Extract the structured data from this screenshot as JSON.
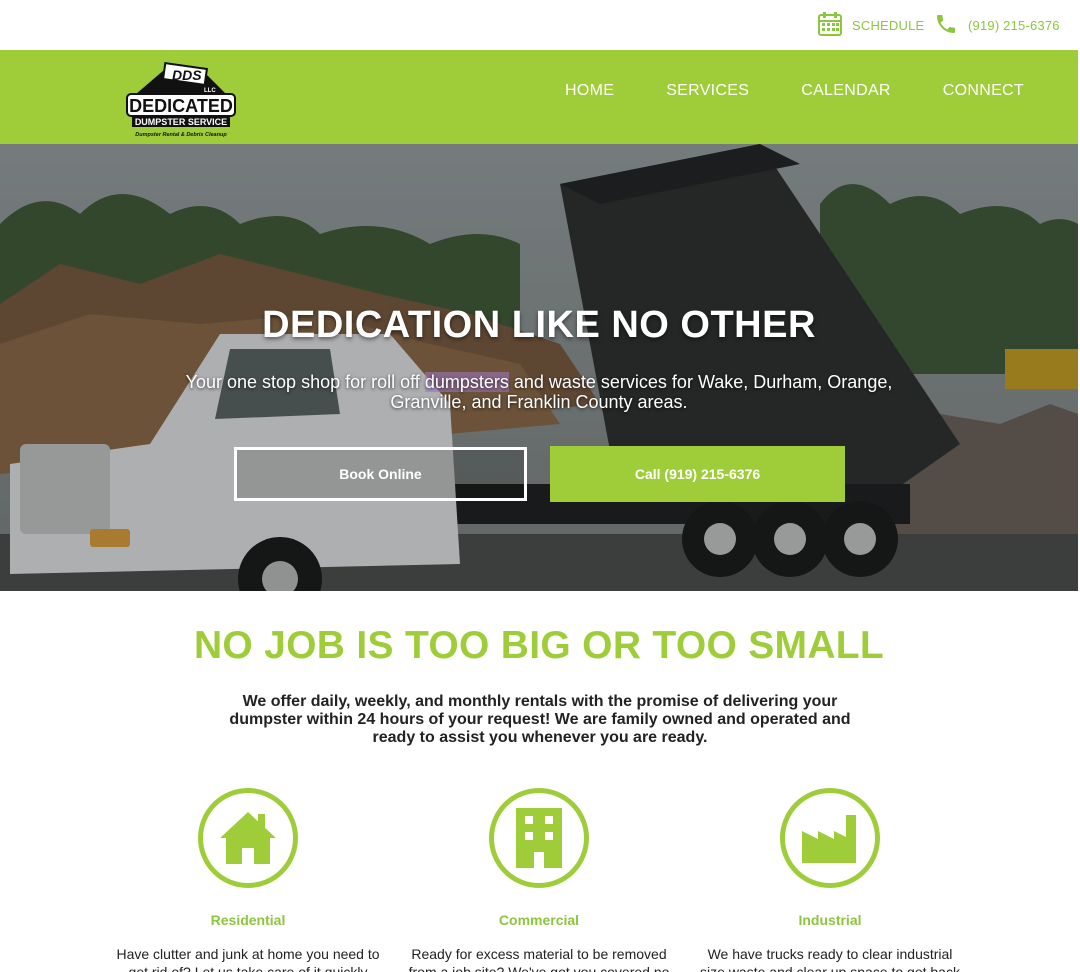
{
  "topbar": {
    "schedule_label": "SCHEDULE",
    "phone_label": "(919) 215-6376",
    "schedule_icon": "calendar-icon",
    "phone_icon": "phone-icon"
  },
  "logo": {
    "mark": "DDS",
    "suffix": "LLC",
    "name_line1": "DEDICATED",
    "name_line2": "DUMPSTER SERVICE",
    "tagline": "Dumpster Rental & Debris Cleanup"
  },
  "nav": {
    "items": [
      {
        "label": "HOME"
      },
      {
        "label": "SERVICES"
      },
      {
        "label": "CALENDAR"
      },
      {
        "label": "CONNECT"
      }
    ]
  },
  "hero": {
    "title": "DEDICATION LIKE NO OTHER",
    "subtitle_before": "Your one stop shop for roll off ",
    "subtitle_highlight": "dumpsters",
    "subtitle_after": " and waste services for Wake, Durham, Orange, Granville, and Franklin County areas.",
    "book_button": "Book Online",
    "call_button": "Call (919) 215-6376"
  },
  "intro": {
    "title": "NO JOB IS TOO BIG OR TOO SMALL",
    "text": "We offer daily, weekly, and monthly rentals with the promise of delivering your dumpster within 24 hours of your request! We are family owned and operated and ready to assist you whenever you are ready."
  },
  "services": [
    {
      "title": "Residential",
      "icon": "house-icon",
      "text": "Have clutter and junk at home you need to get rid of? Let us take care of it quickly and"
    },
    {
      "title": "Commercial",
      "icon": "building-icon",
      "text": "Ready for excess material to be removed from a job site? We've got you covered no"
    },
    {
      "title": "Industrial",
      "icon": "factory-icon",
      "text": "We have trucks ready to clear industrial size waste and clear up space to get back to"
    }
  ],
  "colors": {
    "brand_green": "#9fcd3a",
    "link_green": "#8cc63f",
    "text": "#222222"
  }
}
